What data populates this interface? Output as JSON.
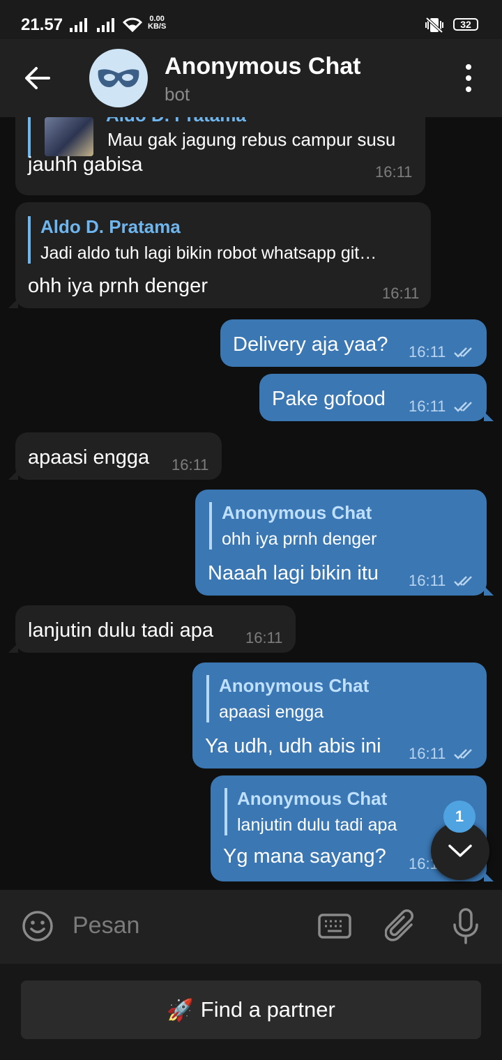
{
  "status_bar": {
    "time": "21.57",
    "net_speed_value": "0.00",
    "net_speed_unit": "KB/S",
    "battery": "32"
  },
  "header": {
    "title": "Anonymous Chat",
    "subtitle": "bot",
    "avatar_icon": "mask-icon"
  },
  "messages": [
    {
      "direction": "incoming",
      "reply_name": "Aldo D. Pratama",
      "reply_text": "Mau gak jagung rebus campur susu",
      "text": "jauhh gabisa",
      "time": "16:11"
    },
    {
      "direction": "incoming",
      "reply_name": "Aldo D. Pratama",
      "reply_text": "Jadi aldo tuh lagi bikin robot whatsapp git…",
      "text": "ohh iya prnh denger",
      "time": "16:11"
    },
    {
      "direction": "outgoing",
      "text": "Delivery aja yaa?",
      "time": "16:11"
    },
    {
      "direction": "outgoing",
      "text": "Pake gofood",
      "time": "16:11"
    },
    {
      "direction": "incoming",
      "text": "apaasi engga",
      "time": "16:11"
    },
    {
      "direction": "outgoing",
      "reply_name": "Anonymous Chat",
      "reply_text": "ohh iya prnh denger",
      "text": "Naaah lagi bikin itu",
      "time": "16:11"
    },
    {
      "direction": "incoming",
      "text": "lanjutin dulu tadi apa",
      "time": "16:11"
    },
    {
      "direction": "outgoing",
      "reply_name": "Anonymous Chat",
      "reply_text": "apaasi engga",
      "text": "Ya udh, udh abis ini",
      "time": "16:11"
    },
    {
      "direction": "outgoing",
      "reply_name": "Anonymous Chat",
      "reply_text": "lanjutin dulu tadi apa",
      "text": "Yg mana sayang?",
      "time": "16:1"
    }
  ],
  "scroll_button": {
    "unread_count": "1"
  },
  "input": {
    "placeholder": "Pesan"
  },
  "bot_keyboard": {
    "button_label": "Find a partner",
    "button_emoji": "🚀"
  },
  "colors": {
    "incoming_bubble": "#212121",
    "outgoing_bubble": "#3a77b3",
    "accent": "#6fb6ef",
    "background": "#0f0f0f"
  }
}
